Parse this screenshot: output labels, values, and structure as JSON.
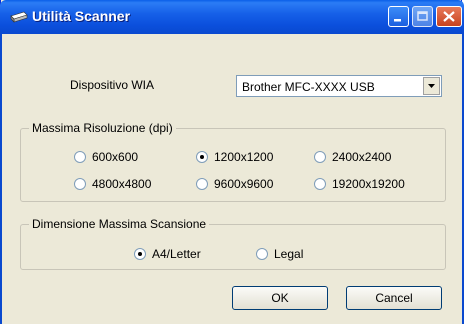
{
  "window": {
    "title": "Utilità Scanner"
  },
  "device": {
    "label": "Dispositivo WIA",
    "selected": "Brother MFC-XXXX USB"
  },
  "resolution": {
    "title": "Massima Risoluzione (dpi)",
    "options": [
      "600x600",
      "1200x1200",
      "2400x2400",
      "4800x4800",
      "9600x9600",
      "19200x19200"
    ],
    "selected": "1200x1200"
  },
  "scan_size": {
    "title": "Dimensione Massima Scansione",
    "options": [
      "A4/Letter",
      "Legal"
    ],
    "selected": "A4/Letter"
  },
  "buttons": {
    "ok": "OK",
    "cancel": "Cancel"
  }
}
